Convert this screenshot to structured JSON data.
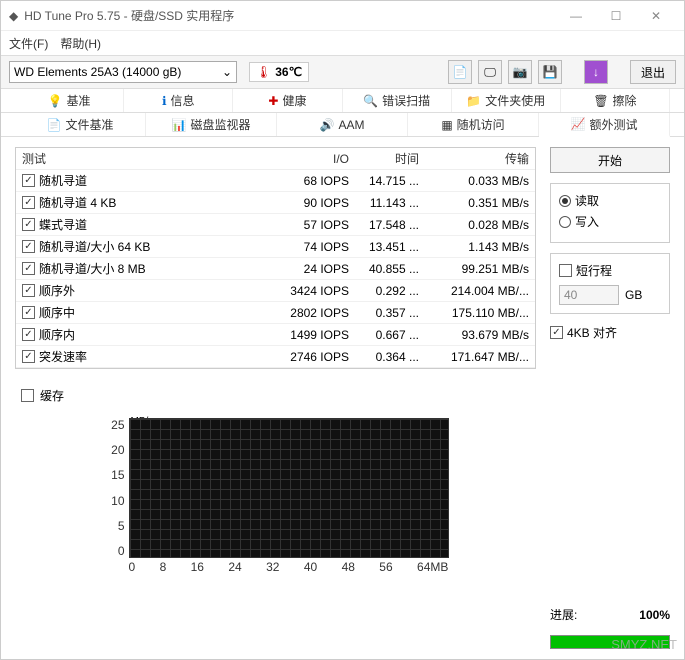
{
  "window": {
    "title": "HD Tune Pro 5.75 - 硬盘/SSD 实用程序"
  },
  "menu": {
    "file": "文件(F)",
    "help": "帮助(H)"
  },
  "toolbar": {
    "drive": "WD    Elements 25A3 (14000 gB)",
    "temperature": "36℃",
    "exit": "退出"
  },
  "tabs1": {
    "benchmark": "基准",
    "info": "信息",
    "health": "健康",
    "errorscan": "错误扫描",
    "folder": "文件夹使用",
    "erase": "擦除"
  },
  "tabs2": {
    "filebench": "文件基准",
    "diskmon": "磁盘监视器",
    "aam": "AAM",
    "random": "随机访问",
    "extra": "额外测试"
  },
  "table": {
    "headers": {
      "test": "测试",
      "io": "I/O",
      "time": "时间",
      "transfer": "传输"
    },
    "rows": [
      {
        "label": "随机寻道",
        "io": "68 IOPS",
        "time": "14.715 ...",
        "tr": "0.033 MB/s"
      },
      {
        "label": "随机寻道 4 KB",
        "io": "90 IOPS",
        "time": "11.143 ...",
        "tr": "0.351 MB/s"
      },
      {
        "label": "蝶式寻道",
        "io": "57 IOPS",
        "time": "17.548 ...",
        "tr": "0.028 MB/s"
      },
      {
        "label": "随机寻道/大小 64 KB",
        "io": "74 IOPS",
        "time": "13.451 ...",
        "tr": "1.143 MB/s"
      },
      {
        "label": "随机寻道/大小 8 MB",
        "io": "24 IOPS",
        "time": "40.855 ...",
        "tr": "99.251 MB/s"
      },
      {
        "label": "顺序外",
        "io": "3424 IOPS",
        "time": "0.292 ...",
        "tr": "214.004 MB/..."
      },
      {
        "label": "顺序中",
        "io": "2802 IOPS",
        "time": "0.357 ...",
        "tr": "175.110 MB/..."
      },
      {
        "label": "顺序内",
        "io": "1499 IOPS",
        "time": "0.667 ...",
        "tr": "93.679 MB/s"
      },
      {
        "label": "突发速率",
        "io": "2746 IOPS",
        "time": "0.364 ...",
        "tr": "171.647 MB/..."
      }
    ]
  },
  "cache": "缓存",
  "chart_data": {
    "type": "line",
    "title": "MB/s",
    "xlabel": "MB",
    "ylabel": "MB/s",
    "x_ticks": [
      "0",
      "8",
      "16",
      "24",
      "32",
      "40",
      "48",
      "56",
      "64MB"
    ],
    "y_ticks": [
      "25",
      "20",
      "15",
      "10",
      "5",
      "0"
    ],
    "xlim": [
      0,
      64
    ],
    "ylim": [
      0,
      25
    ],
    "series": []
  },
  "right": {
    "start": "开始",
    "read": "读取",
    "write": "写入",
    "short": "短行程",
    "short_val": "40",
    "short_unit": "GB",
    "align": "4KB 对齐",
    "progress_label": "进展:",
    "progress_val": "100%"
  },
  "watermark": "SMYZ.NET"
}
